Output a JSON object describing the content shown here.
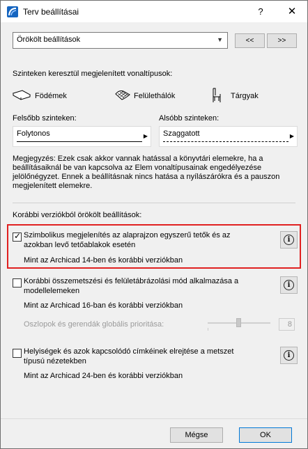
{
  "window": {
    "title": "Terv beállításai",
    "help": "?",
    "close": "✕"
  },
  "preset": {
    "value": "Örökölt beállítások",
    "prev": "<<",
    "next": ">>"
  },
  "linetypes": {
    "heading": "Szinteken keresztül megjelenített vonaltípusok:",
    "items": [
      "Födémek",
      "Felülethálók",
      "Tárgyak"
    ]
  },
  "upper": {
    "label": "Felsőbb szinteken:",
    "value": "Folytonos"
  },
  "lower": {
    "label": "Alsóbb szinteken:",
    "value": "Szaggatott"
  },
  "note": "Megjegyzés: Ezek csak akkor vannak hatással a könyvtári elemekre, ha a beállításaiknál be van kapcsolva az Elem vonaltípusainak engedélyezése jelölőnégyzet. Ennek a beállításnak nincs hatása a nyílászárókra és a pauszon megjelenített elemekre.",
  "legacy": {
    "heading": "Korábbi verziókból örökölt beállítások:",
    "options": [
      {
        "label": "Szimbolikus megjelenítés az alaprajzon egyszerű tetők és az azokban levő tetőablakok esetén",
        "sub": "Mint az Archicad 14-ben és korábbi verziókban",
        "checked": true
      },
      {
        "label": "Korábbi összemetszési és felületábrázolási mód alkalmazása a modellelemeken",
        "sub": "Mint az Archicad 16-ban és korábbi verziókban",
        "checked": false
      },
      {
        "label": "Helyiségek és azok kapcsolódó címkéinek elrejtése a metszet típusú nézetekben",
        "sub": "Mint az Archicad 24-ben és korábbi verziókban",
        "checked": false
      }
    ],
    "priority": {
      "label": "Oszlopok és gerendák globális prioritása:",
      "value": "8",
      "level": 0.5
    }
  },
  "buttons": {
    "cancel": "Mégse",
    "ok": "OK"
  },
  "colors": {
    "highlight": "#e02020",
    "default_border": "#0078d7"
  }
}
